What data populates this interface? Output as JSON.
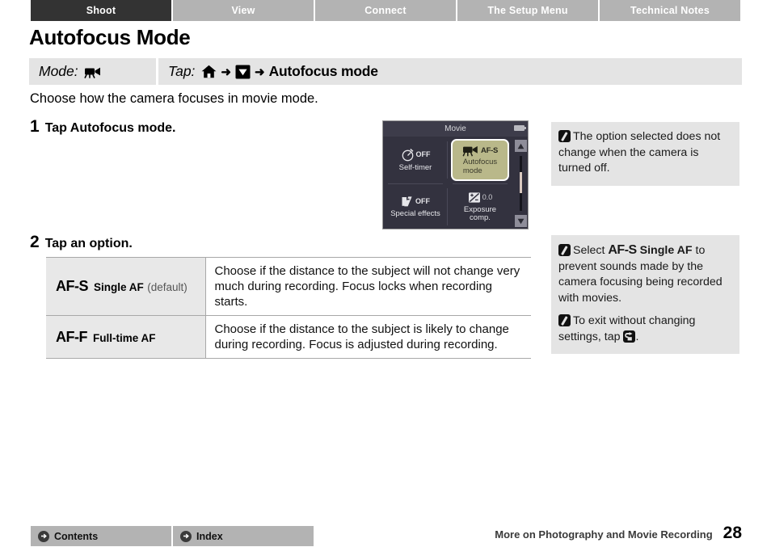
{
  "tabs": [
    {
      "label": "Shoot",
      "active": true
    },
    {
      "label": "View",
      "active": false
    },
    {
      "label": "Connect",
      "active": false
    },
    {
      "label": "The Setup Menu",
      "active": false
    },
    {
      "label": "Technical Notes",
      "active": false
    }
  ],
  "page_title": "Autofocus Mode",
  "modebar": {
    "mode_label": "Mode:",
    "mode_icon": "movie-camera-icon",
    "tap_label": "Tap:",
    "tap_icon_1": "home-icon",
    "tap_arrow": "➜",
    "tap_icon_2": "down-triangle-icon",
    "tap_target": "Autofocus mode"
  },
  "intro": "Choose how the camera focuses in movie mode.",
  "steps": [
    {
      "num": "1",
      "text": "Tap Autofocus mode."
    },
    {
      "num": "2",
      "text": "Tap an option."
    }
  ],
  "lcd": {
    "header": "Movie",
    "battery_icon": "battery-icon",
    "cells": [
      {
        "name": "self-timer",
        "icon": "self-timer-icon",
        "value": "OFF",
        "caption": "Self-timer"
      },
      {
        "name": "autofocus-mode",
        "icon": "movie-af-icon",
        "value": "AF-S",
        "caption": "Autofocus\nmode",
        "caption_line1": "Autofocus",
        "caption_line2": "mode",
        "selected": true
      },
      {
        "name": "special-effects",
        "icon": "special-effects-icon",
        "value": "OFF",
        "caption": "Special effects"
      },
      {
        "name": "exposure-comp",
        "icon": "exposure-comp-icon",
        "value": "0.0",
        "caption_line1": "Exposure",
        "caption_line2": "comp."
      }
    ],
    "scroll_up_icon": "scroll-up-icon",
    "scroll_down_icon": "scroll-down-icon",
    "selected_bg": "#b9b88a"
  },
  "options_table": {
    "rows": [
      {
        "code": "AF-S",
        "name": "Single AF",
        "default_note": "(default)",
        "description": "Choose if the distance to the subject will not change very much during recording. Focus locks when recording starts."
      },
      {
        "code": "AF-F",
        "name": "Full-time AF",
        "default_note": "",
        "description": "Choose if the distance to the subject is likely to change during recording. Focus is adjusted during recording."
      }
    ]
  },
  "notes": [
    {
      "icon": "pencil-note-icon",
      "paragraphs": [
        {
          "pre": "The option selected does not change when the camera is turned off.",
          "bold": "",
          "post": ""
        }
      ]
    },
    {
      "icon": "pencil-note-icon",
      "paragraphs": [
        {
          "pre": "Select ",
          "code": "AF-S",
          "bold": "Single AF",
          "post": " to prevent sounds made by the camera focusing being recorded with movies."
        },
        {
          "pre": "To exit without changing settings, tap ",
          "icon": "back-arrow-icon",
          "post": "."
        }
      ]
    }
  ],
  "footer": {
    "buttons": [
      {
        "label": "Contents",
        "icon": "circle-arrow-icon"
      },
      {
        "label": "Index",
        "icon": "circle-arrow-icon"
      }
    ],
    "section": "More on Photography and Movie Recording",
    "page_number": "28"
  }
}
